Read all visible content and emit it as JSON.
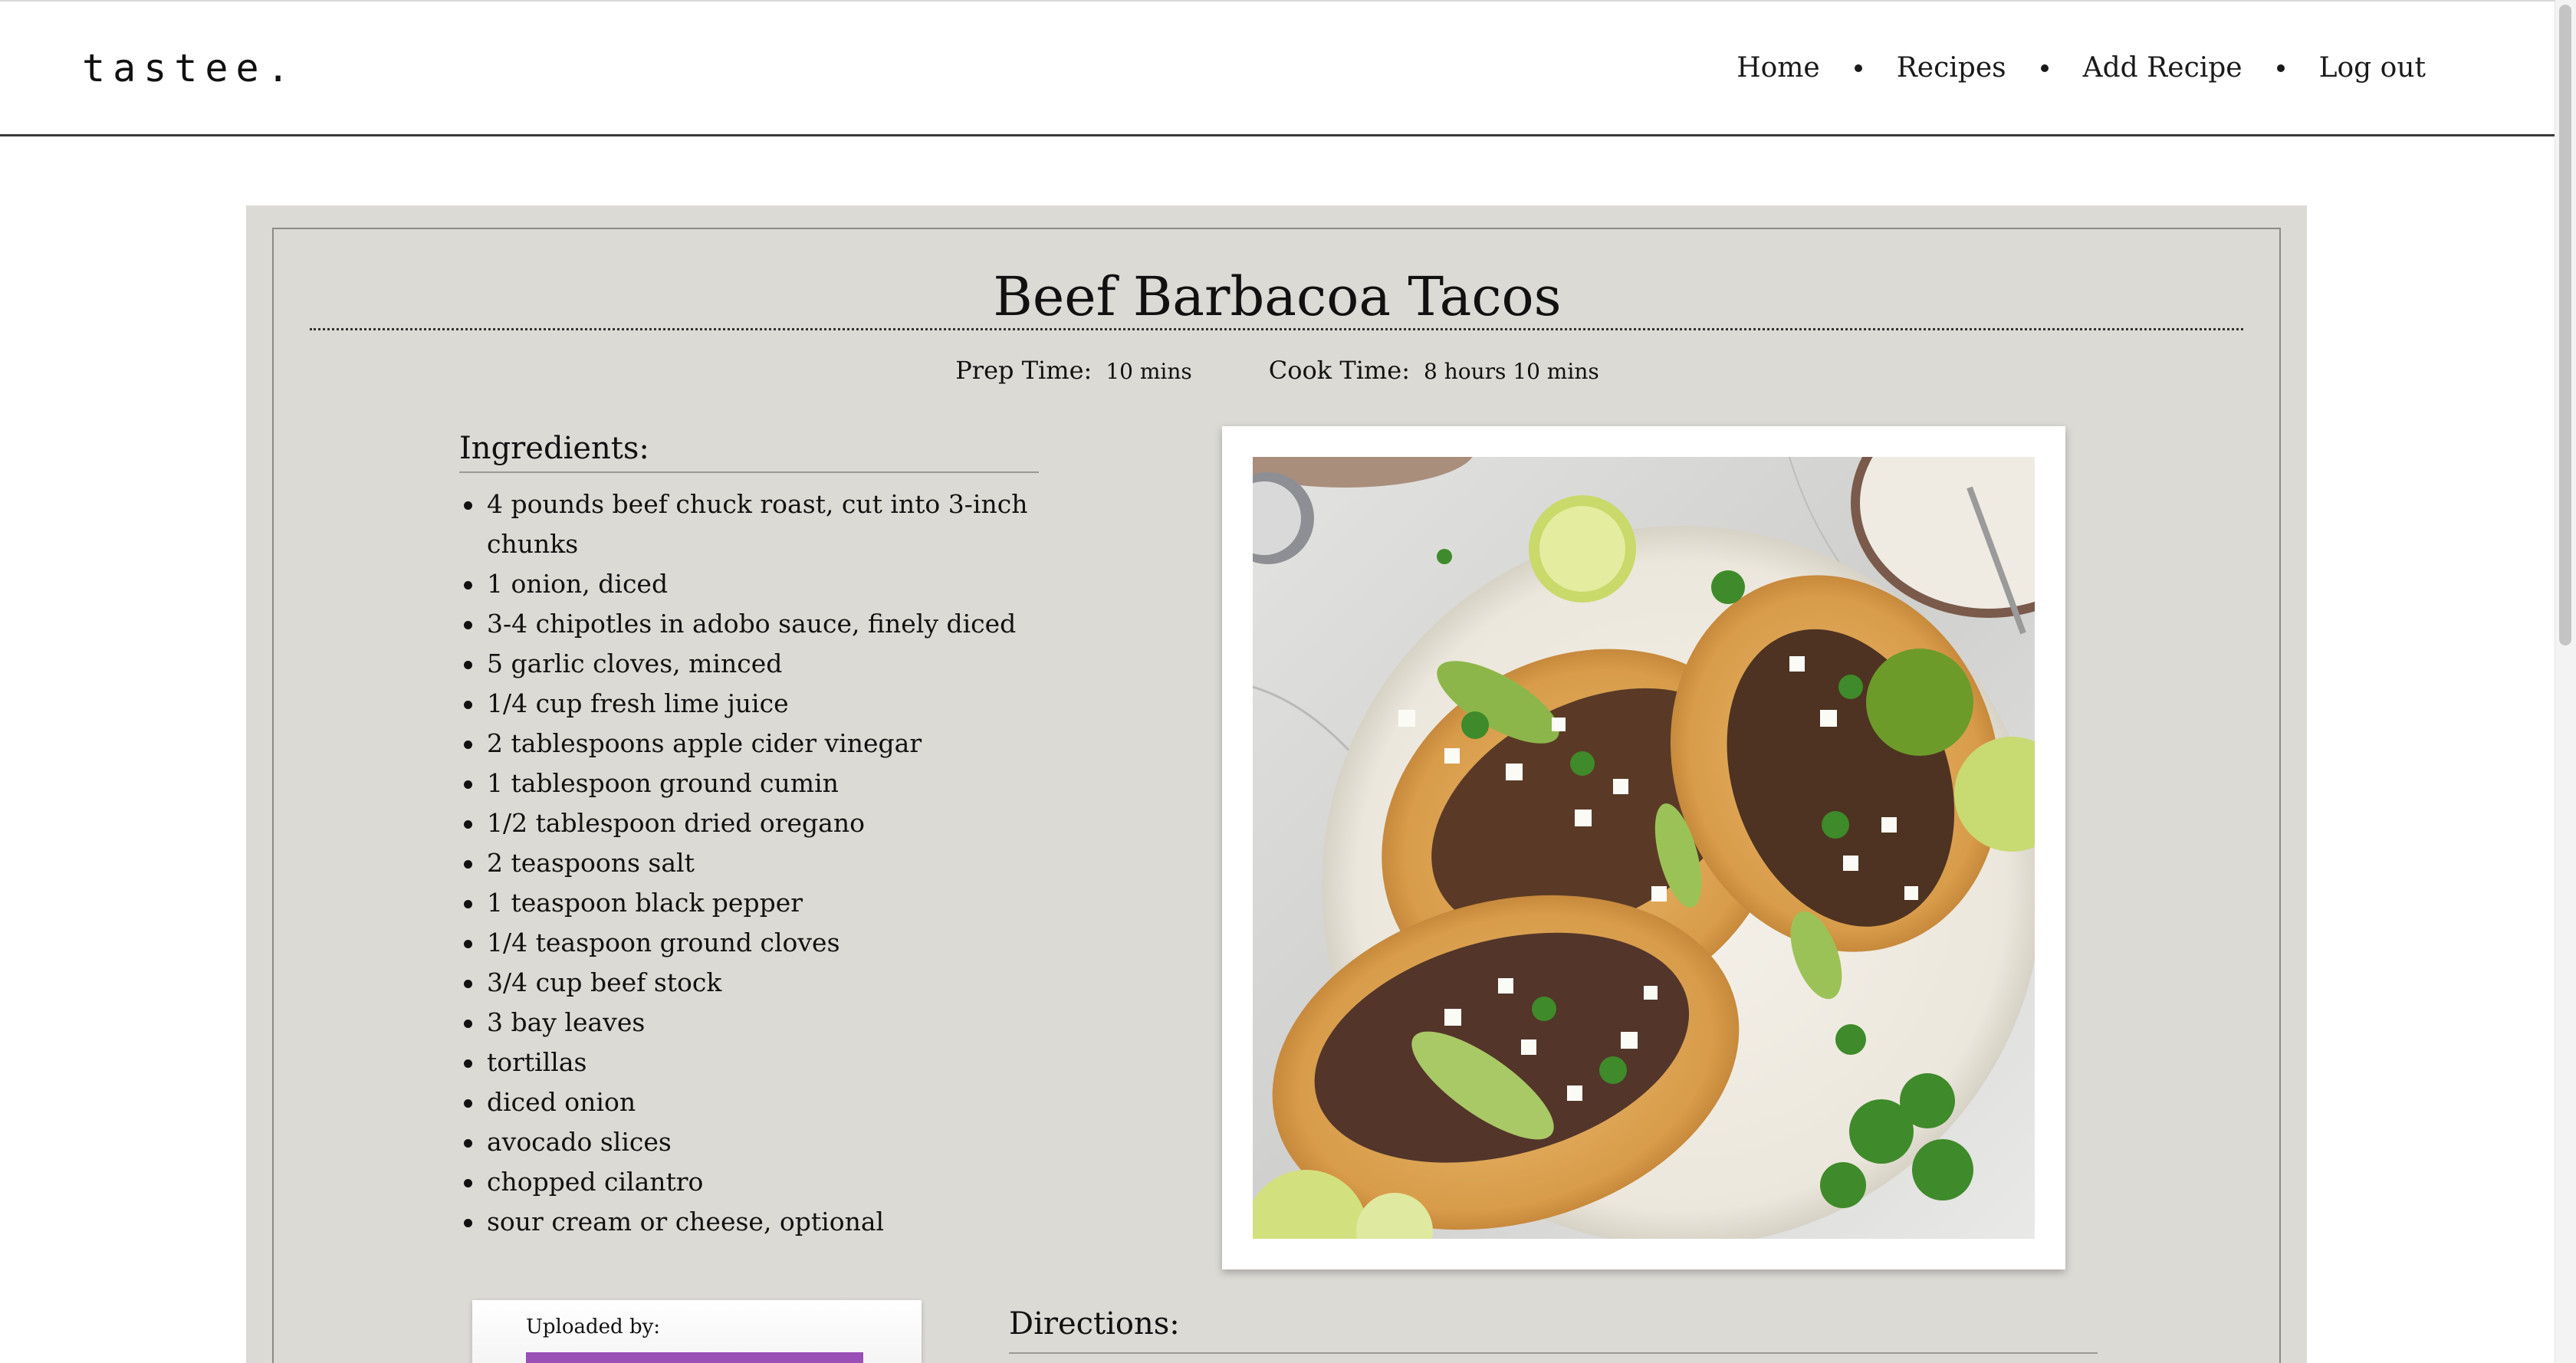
{
  "brand": {
    "logo": "tastee."
  },
  "nav": {
    "items": [
      {
        "label": "Home"
      },
      {
        "label": "Recipes"
      },
      {
        "label": "Add Recipe"
      },
      {
        "label": "Log out"
      }
    ]
  },
  "recipe": {
    "title": "Beef Barbacoa Tacos",
    "prep_time_label": "Prep Time:",
    "prep_time_value": "10 mins",
    "cook_time_label": "Cook Time:",
    "cook_time_value": "8 hours 10 mins",
    "ingredients_heading": "Ingredients:",
    "ingredients": [
      "4 pounds beef chuck roast, cut into 3-inch chunks",
      "1 onion, diced",
      "3-4 chipotles in adobo sauce, finely diced",
      "5 garlic cloves, minced",
      "1/4 cup fresh lime juice",
      "2 tablespoons apple cider vinegar",
      "1 tablespoon ground cumin",
      "1/2 tablespoon dried oregano",
      "2 teaspoons salt",
      "1 teaspoon black pepper",
      "1/4 teaspoon ground cloves",
      "3/4 cup beef stock",
      "3 bay leaves",
      "tortillas",
      "diced onion",
      "avocado slices",
      "chopped cilantro",
      "sour cream or cheese, optional"
    ],
    "uploaded_by_label": "Uploaded by:",
    "directions_heading": "Directions:"
  },
  "colors": {
    "card_background": "#dcdad5",
    "uploader_accent": "#9a4fb4"
  }
}
